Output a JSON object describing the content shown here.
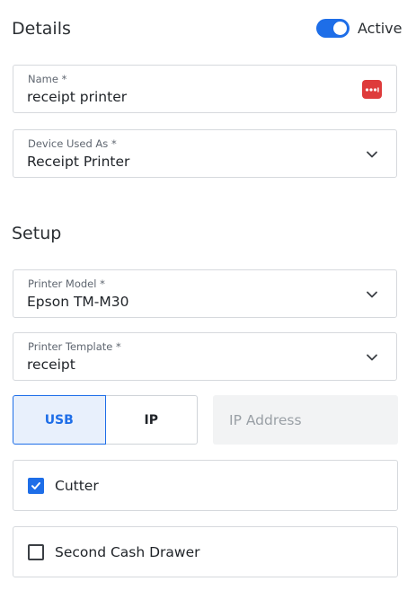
{
  "details": {
    "title": "Details",
    "active_toggle": {
      "label": "Active",
      "on": true
    },
    "name_field": {
      "label": "Name *",
      "value": "receipt printer",
      "icon": "dots-menu-icon"
    },
    "device_used_as": {
      "label": "Device Used As *",
      "value": "Receipt Printer"
    }
  },
  "setup": {
    "title": "Setup",
    "printer_model": {
      "label": "Printer Model *",
      "value": "Epson TM-M30"
    },
    "printer_template": {
      "label": "Printer Template *",
      "value": "receipt"
    },
    "connection": {
      "options": [
        "USB",
        "IP"
      ],
      "selected": "USB",
      "ip_placeholder": "IP Address"
    },
    "cutter": {
      "label": "Cutter",
      "checked": true
    },
    "second_cash_drawer": {
      "label": "Second Cash Drawer",
      "checked": false
    }
  },
  "colors": {
    "accent": "#1e6ee8",
    "menu_icon_bg": "#de3b3b"
  }
}
